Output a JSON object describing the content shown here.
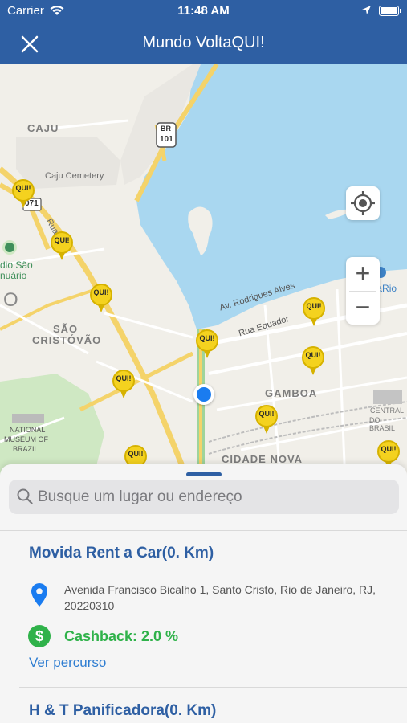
{
  "status_bar": {
    "carrier": "Carrier",
    "time": "11:48 AM"
  },
  "nav": {
    "title": "Mundo VoltaQUI!",
    "close_icon": "close-icon"
  },
  "map": {
    "labels": {
      "caju": "CAJU",
      "caju_cemetery": "Caju Cemetery",
      "br": "BR",
      "br_num": "101",
      "route_071": "071",
      "rua": "Rua",
      "estadio_1": "dio São",
      "estadio_2": "nuário",
      "o": "O",
      "sao": "SÃO",
      "cristovao": "CRISTÓVÃO",
      "av_rodrigues": "Av. Rodrigues Alves",
      "rua_equador": "Rua Equador",
      "aquario": "AquaRio",
      "gamboa": "GAMBOA",
      "cidade_nova": "CIDADE NOVA",
      "central_1": "CENTRAL",
      "central_2": "DO BRASIL",
      "museum_1": "NATIONAL",
      "museum_2": "MUSEUM OF",
      "museum_3": "BRAZIL"
    },
    "pin_label": "QUI!",
    "colors": {
      "water": "#a9d7f0",
      "road_major": "#f4d36a",
      "park": "#cfe8c3",
      "pin": "#f4d21f",
      "user": "#1a7cf0"
    }
  },
  "search": {
    "placeholder": "Busque um lugar ou endereço"
  },
  "places": [
    {
      "name": "Movida Rent a Car(0. Km)",
      "address": "Avenida Francisco Bicalho 1, Santo Cristo, Rio de Janeiro, RJ, 20220310",
      "cashback": "Cashback: 2.0 %",
      "cash_symbol": "$",
      "route": "Ver percurso"
    },
    {
      "name": "H & T Panificadora(0. Km)"
    }
  ]
}
